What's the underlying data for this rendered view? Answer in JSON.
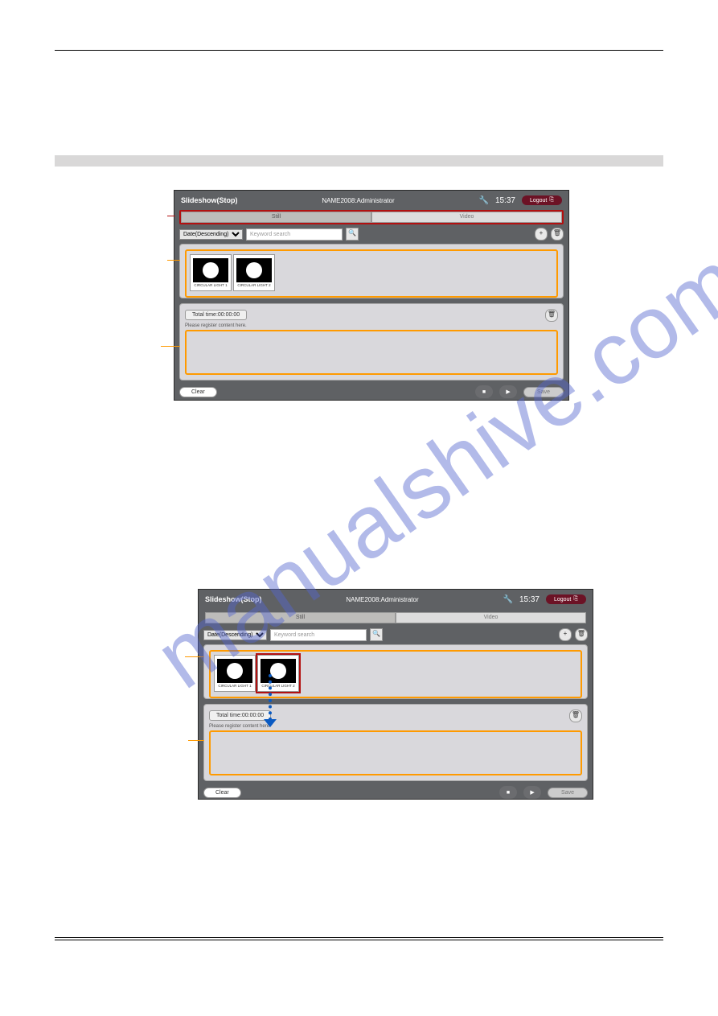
{
  "header": {
    "title": "Slideshow(Stop)",
    "user": "NAME2008:Administrator",
    "time": "15:37",
    "logout": "Logout"
  },
  "tabs": {
    "still": "Still",
    "video": "Video"
  },
  "toolbar": {
    "sort": "Date(Descending)",
    "search_placeholder": "Keyword search"
  },
  "thumbs": {
    "t1": "CIRCULAR LIGHT 1",
    "t2": "CIRCULAR LIGHT 2"
  },
  "slideshow": {
    "total": "Total time:00:00:00",
    "hint": "Please register content here."
  },
  "buttons": {
    "clear": "Clear",
    "save": "Save"
  },
  "watermark": "manualshive.com"
}
